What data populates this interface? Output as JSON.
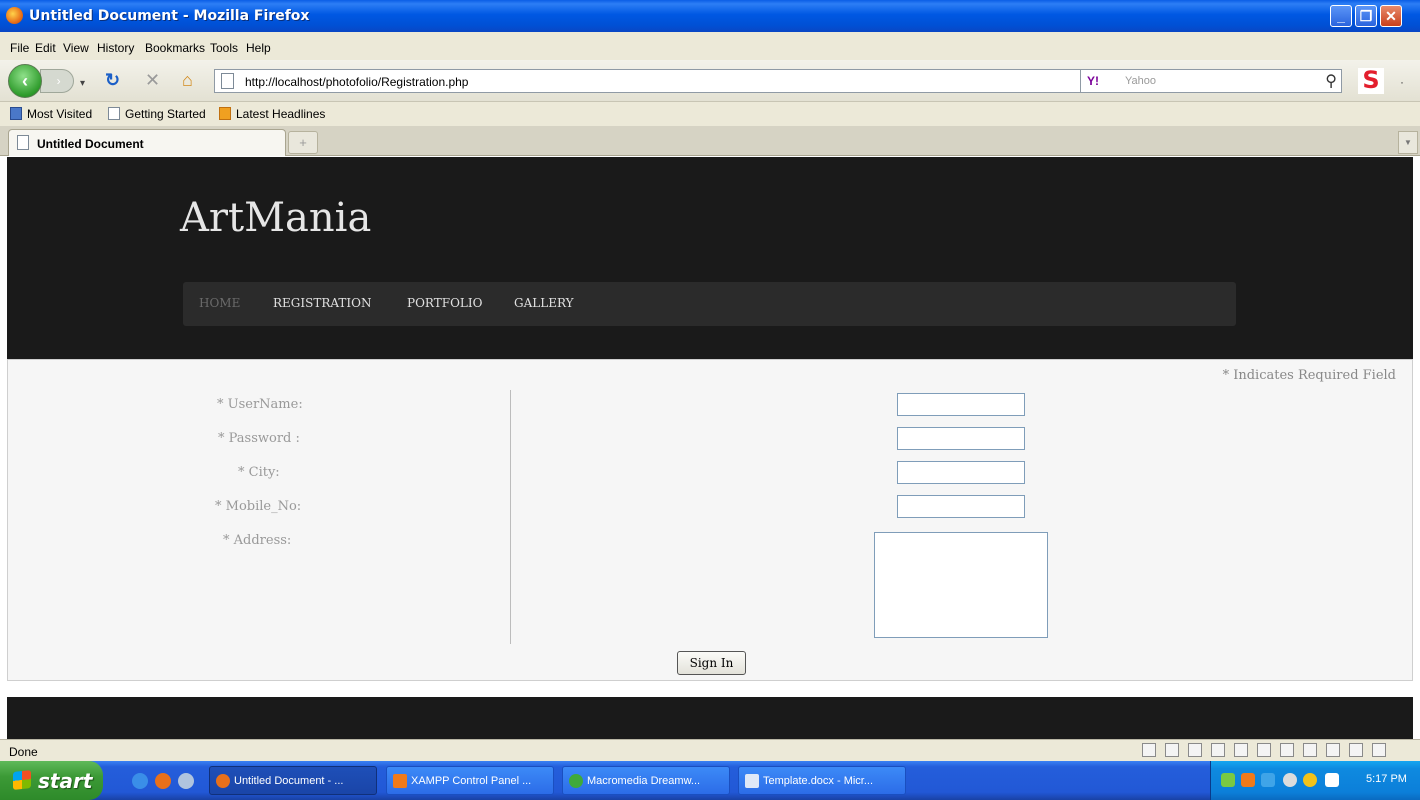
{
  "window": {
    "title": "Untitled Document - Mozilla Firefox"
  },
  "menu": [
    "File",
    "Edit",
    "View",
    "History",
    "Bookmarks",
    "Tools",
    "Help"
  ],
  "urlbar": {
    "url": "http://localhost/photofolio/Registration.php"
  },
  "search": {
    "placeholder": "Yahoo",
    "engine_label": "Y!"
  },
  "bookmarks": [
    "Most Visited",
    "Getting Started",
    "Latest Headlines"
  ],
  "tabs": [
    {
      "label": "Untitled Document",
      "active": true
    }
  ],
  "site": {
    "logo": "ArtMania",
    "nav": [
      {
        "label": "HOME",
        "active": true
      },
      {
        "label": "REGISTRATION",
        "active": false
      },
      {
        "label": "PORTFOLIO",
        "active": false
      },
      {
        "label": "GALLERY",
        "active": false
      }
    ]
  },
  "form": {
    "required_note": "* Indicates Required Field",
    "labels": {
      "username": "* UserName:",
      "password": "* Password :",
      "city": "* City:",
      "mobile": "* Mobile_No:",
      "address": "* Address:"
    },
    "submit_label": "Sign In"
  },
  "status": {
    "text": "Done"
  },
  "taskbar": {
    "start_label": "start",
    "items": [
      {
        "label": "Untitled Document - ...",
        "active": true
      },
      {
        "label": "XAMPP Control Panel ...",
        "active": false
      },
      {
        "label": "Macromedia Dreamw...",
        "active": false
      },
      {
        "label": "Template.docx - Micr...",
        "active": false
      }
    ],
    "clock": "5:17 PM"
  },
  "colors": {
    "site_header_bg": "#1a1a1a",
    "site_nav_bg": "#2b2b2b",
    "form_bg": "#f6f6f6",
    "xp_title_blue": "#0058e3",
    "xp_start_green": "#3c9a36"
  }
}
